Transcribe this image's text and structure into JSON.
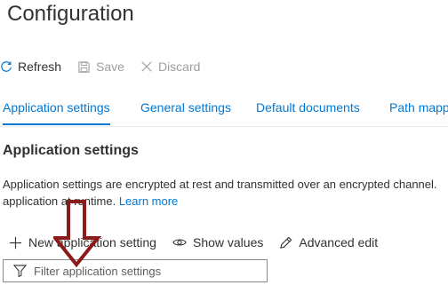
{
  "page": {
    "title": "Configuration"
  },
  "commands": {
    "refresh": "Refresh",
    "save": "Save",
    "discard": "Discard"
  },
  "tabs": [
    {
      "label": "Application settings",
      "active": true
    },
    {
      "label": "General settings",
      "active": false
    },
    {
      "label": "Default documents",
      "active": false
    },
    {
      "label": "Path mapp",
      "active": false
    }
  ],
  "section": {
    "heading": "Application settings",
    "description": "Application settings are encrypted at rest and transmitted over an encrypted channel.",
    "description_cont": "application at runtime.",
    "learn_more": "Learn more"
  },
  "toolbar": {
    "new_setting": "New application setting",
    "show_values": "Show values",
    "advanced_edit": "Advanced edit"
  },
  "filter": {
    "placeholder": "Filter application settings"
  },
  "colors": {
    "accent": "#0078d4",
    "text": "#323130",
    "disabled": "#a19f9d",
    "annotation_arrow": "#8b1a1a"
  },
  "icons": {
    "refresh": "refresh-icon",
    "save": "save-icon",
    "discard": "close-icon",
    "new": "plus-icon",
    "show": "eye-icon",
    "edit": "pencil-icon",
    "filter": "filter-icon"
  }
}
